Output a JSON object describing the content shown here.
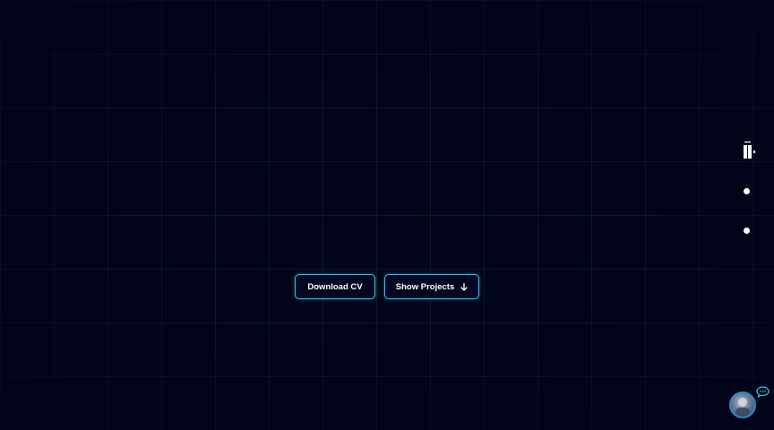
{
  "hero": {
    "download_cv_label": "Download CV",
    "show_projects_label": "Show Projects"
  },
  "side_nav": {
    "logo_icon": "logo-icon",
    "dots": [
      "nav-dot",
      "nav-dot"
    ]
  },
  "chat": {
    "avatar_icon": "avatar",
    "bubble_icon": "chat-bubble-icon"
  },
  "colors": {
    "background": "#02041a",
    "grid": "#1c3a48",
    "accent": "#2fc6e6",
    "text": "#ffffff"
  }
}
